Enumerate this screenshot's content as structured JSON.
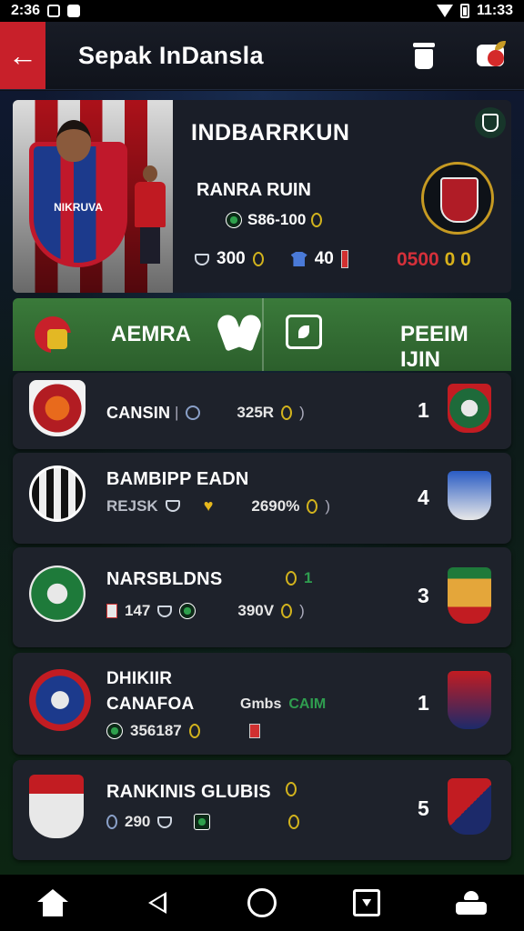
{
  "status_bar": {
    "time_left": "2:36",
    "time_right": "11:33"
  },
  "app_bar": {
    "title": "Sepak InDansla"
  },
  "hero": {
    "title": "INDBARRKUN",
    "subtitle": "RANRA RUIN",
    "stat_primary": "S86-100",
    "stat_a": "300",
    "stat_b": "40",
    "score_red": "0500",
    "score_gold": "0 0",
    "crest_text": "NIKRUVA"
  },
  "tabs": {
    "left_label": "AEMRA",
    "right_label": "PEEIM IJIN"
  },
  "rows": [
    {
      "name": "CANSIN",
      "stat1": "325R",
      "count": "1"
    },
    {
      "name": "BAMBIPP EADN",
      "sub": "REJSK",
      "stat1": "2690%",
      "count": "4"
    },
    {
      "name": "NARSBLDNS",
      "stat_a": "147",
      "stat1": "390V",
      "count": "3"
    },
    {
      "name": "DHIKIIR",
      "name2": "CANAFOA",
      "stat_a": "356187",
      "tag": "Gmbs",
      "tag_green": "CAIM",
      "count": "1"
    },
    {
      "name": "RANKINIS GLUBIS",
      "stat_a": "290",
      "count": "5"
    }
  ],
  "colors": {
    "accent_red": "#c8202a",
    "pitch_green": "#3a7a3a",
    "card_bg": "#1e222b",
    "gold": "#d2b31d"
  },
  "icons": [
    "back-arrow-icon",
    "trash-icon",
    "notification-icon",
    "shield-icon",
    "home-icon",
    "back-icon",
    "circle-home-icon",
    "recents-icon",
    "team-icon"
  ]
}
